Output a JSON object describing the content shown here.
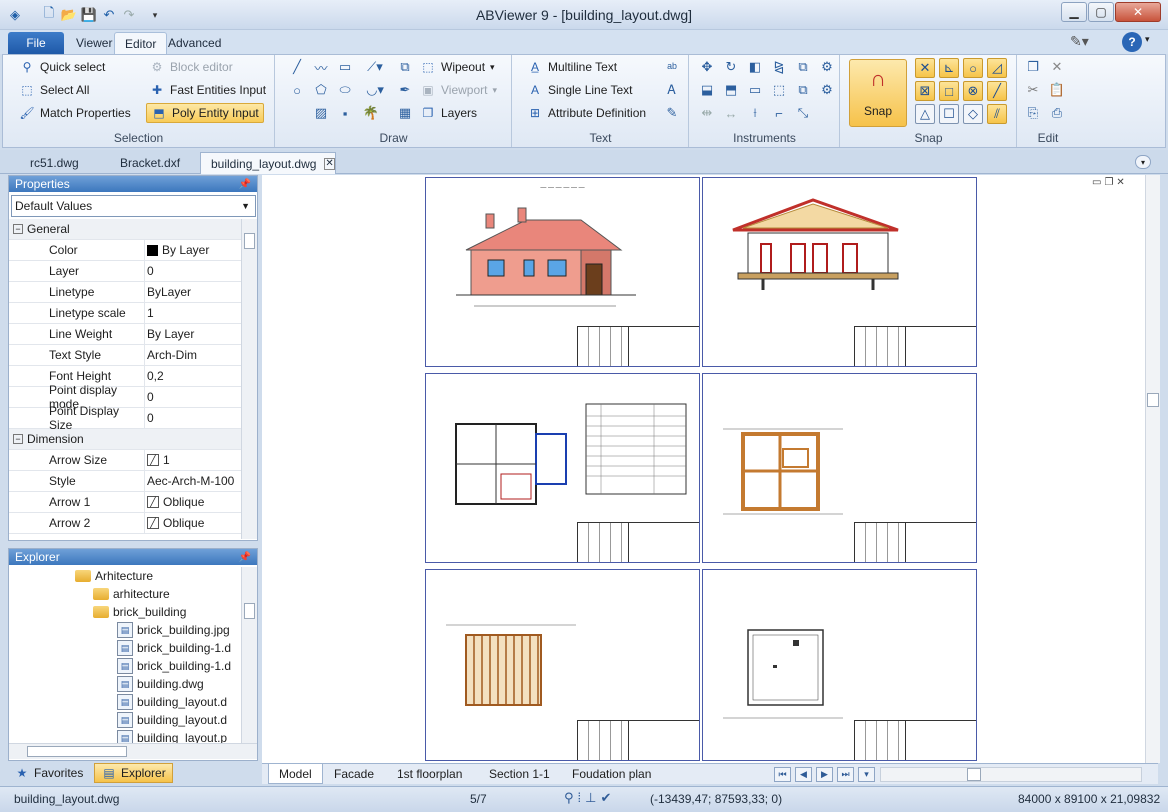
{
  "window": {
    "title": "ABViewer 9 - [building_layout.dwg]"
  },
  "ribbon_tabs": [
    "File",
    "Viewer",
    "Editor",
    "Advanced"
  ],
  "ribbon": {
    "selection": {
      "label": "Selection",
      "quick_select": "Quick select",
      "select_all": "Select All",
      "match_properties": "Match Properties",
      "block_editor": "Block editor",
      "fast_entities": "Fast Entities Input",
      "poly_entity": "Poly Entity Input"
    },
    "draw": {
      "label": "Draw",
      "wipeout": "Wipeout",
      "viewport": "Viewport",
      "layers": "Layers"
    },
    "text": {
      "label": "Text",
      "multiline": "Multiline Text",
      "single_line": "Single Line Text",
      "attribute_def": "Attribute Definition"
    },
    "instruments": {
      "label": "Instruments"
    },
    "snap": {
      "label": "Snap",
      "snap_button": "Snap"
    },
    "edit": {
      "label": "Edit"
    }
  },
  "doc_tabs": [
    "rc51.dwg",
    "Bracket.dxf",
    "building_layout.dwg"
  ],
  "properties": {
    "title": "Properties",
    "dropdown": "Default Values",
    "rows": [
      {
        "type": "cat",
        "name": "General"
      },
      {
        "name": "Color",
        "value": "By Layer"
      },
      {
        "name": "Layer",
        "value": "0"
      },
      {
        "name": "Linetype",
        "value": "ByLayer"
      },
      {
        "name": "Linetype scale",
        "value": "1"
      },
      {
        "name": "Line Weight",
        "value": "By Layer"
      },
      {
        "name": "Text Style",
        "value": "Arch-Dim"
      },
      {
        "name": "Font Height",
        "value": "0,2"
      },
      {
        "name": "Point display mode",
        "value": "0"
      },
      {
        "name": "Point Display Size",
        "value": "0"
      },
      {
        "type": "cat",
        "name": "Dimension"
      },
      {
        "name": "Arrow Size",
        "value": "1"
      },
      {
        "name": "Style",
        "value": "Aec-Arch-M-100"
      },
      {
        "name": "Arrow 1",
        "value": "Oblique"
      },
      {
        "name": "Arrow 2",
        "value": "Oblique"
      }
    ]
  },
  "explorer": {
    "title": "Explorer",
    "items": [
      {
        "indent": 66,
        "kind": "folder",
        "label": "Arhitecture"
      },
      {
        "indent": 84,
        "kind": "folder",
        "label": "arhitecture"
      },
      {
        "indent": 84,
        "kind": "folder",
        "label": "brick_building"
      },
      {
        "indent": 108,
        "kind": "file",
        "label": "brick_building.jpg"
      },
      {
        "indent": 108,
        "kind": "file",
        "label": "brick_building-1.d"
      },
      {
        "indent": 108,
        "kind": "file",
        "label": "brick_building-1.d"
      },
      {
        "indent": 108,
        "kind": "file",
        "label": "building.dwg"
      },
      {
        "indent": 108,
        "kind": "file",
        "label": "building_layout.d"
      },
      {
        "indent": 108,
        "kind": "file",
        "label": "building_layout.d"
      },
      {
        "indent": 108,
        "kind": "file",
        "label": "building_layout.p"
      }
    ],
    "tabs": [
      "Favorites",
      "Explorer"
    ]
  },
  "layout_tabs": [
    "Model",
    "Facade",
    "1st floorplan",
    "Section 1-1",
    "Foudation plan"
  ],
  "status": {
    "file": "building_layout.dwg",
    "page": "5/7",
    "coords": "(-13439,47; 87593,33; 0)",
    "size": "84000 x 89100 x 21,09832"
  },
  "colors": {
    "accent": "#1f59a8",
    "highlight": "#f8cb58",
    "ribbon_bg": "#e4ecf7"
  }
}
